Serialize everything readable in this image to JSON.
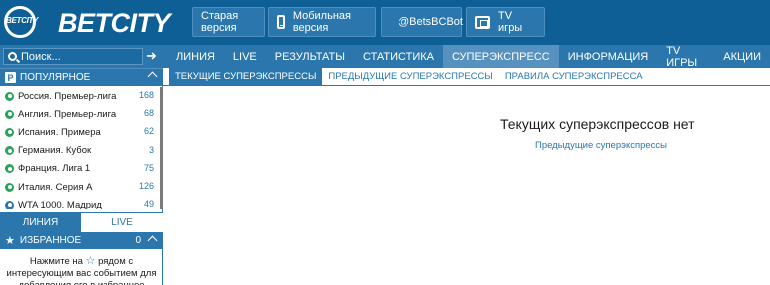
{
  "header": {
    "logo_small": "BETCITY",
    "logo_text": "BETCITY",
    "buttons": {
      "old_version": "Старая версия",
      "mobile_version": "Мобильная версия",
      "telegram": "@BetsBCBot",
      "tv_games": "TV игры"
    }
  },
  "search": {
    "placeholder": "Поиск..."
  },
  "popular": {
    "title": "ПОПУЛЯРНОЕ",
    "badge": "P",
    "items": [
      {
        "name": "Россия. Премьер-лига",
        "count": "168",
        "sport": "football"
      },
      {
        "name": "Англия. Премьер-лига",
        "count": "68",
        "sport": "football"
      },
      {
        "name": "Испания. Примера",
        "count": "62",
        "sport": "football"
      },
      {
        "name": "Германия. Кубок",
        "count": "3",
        "sport": "football"
      },
      {
        "name": "Франция. Лига 1",
        "count": "75",
        "sport": "football"
      },
      {
        "name": "Италия. Серия А",
        "count": "126",
        "sport": "football"
      },
      {
        "name": "WTA 1000. Мадрид",
        "count": "49",
        "sport": "tennis"
      }
    ]
  },
  "side_tabs": {
    "line": "ЛИНИЯ",
    "live": "LIVE"
  },
  "favorites": {
    "title": "ИЗБРАННОЕ",
    "count": "0",
    "text_before": "Нажмите на",
    "text_after": "рядом с интересующим вас событием для добавления его в избранное"
  },
  "nav": {
    "items": [
      "ЛИНИЯ",
      "LIVE",
      "РЕЗУЛЬТАТЫ",
      "СТАТИСТИКА",
      "СУПЕРЭКСПРЕСС",
      "ИНФОРМАЦИЯ",
      "TV ИГРЫ",
      "АКЦИИ"
    ],
    "active_index": 4
  },
  "subtabs": {
    "current": "ТЕКУЩИЕ СУПЕРЭКСПРЕССЫ",
    "previous": "ПРЕДЫДУЩИЕ СУПЕРЭКСПРЕССЫ",
    "rules": "ПРАВИЛА СУПЕРЭКСПРЕССА"
  },
  "main": {
    "empty_title": "Текущих суперэкспрессов нет",
    "previous_link": "Предыдущие суперэкспрессы"
  },
  "colors": {
    "brand": "#0f5f97",
    "accent": "#2b77ad",
    "football": "#27a35a"
  }
}
